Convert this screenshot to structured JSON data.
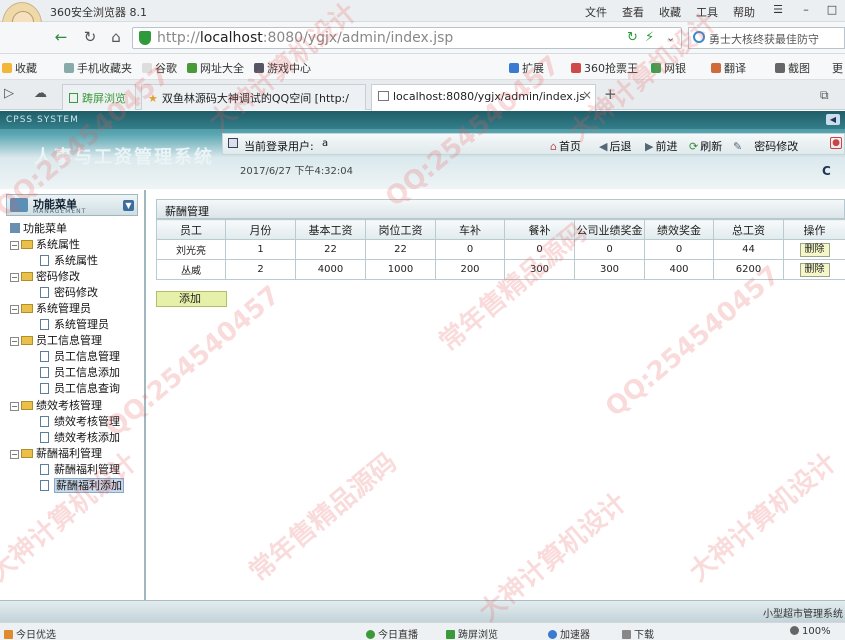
{
  "browser": {
    "title": "360安全浏览器 8.1",
    "menu": [
      "文件",
      "查看",
      "收藏",
      "工具",
      "帮助"
    ],
    "url_prefix": "http://",
    "url_host": "localhost",
    "url_rest": ":8080/ygjx/admin/index.jsp",
    "search_text": "勇士大核终获最佳防守",
    "bookmarks": [
      "收藏",
      "手机收藏夹",
      "谷歌",
      "网址大全",
      "游戏中心",
      "扩展",
      "360抢票王",
      "网银",
      "翻译",
      "截图",
      "更"
    ],
    "tabs": [
      {
        "label": "踌屏浏览"
      },
      {
        "label": "双鱼林源码大神调试的QQ空间 [http:/"
      },
      {
        "label": "localhost:8080/ygjx/admin/index.js"
      }
    ],
    "status_right": "小型超市管理系统",
    "bottom_left": "今日优选",
    "bottom_items": [
      "今日直播",
      "踌屏浏览",
      "加速器",
      "下载",
      "100%"
    ]
  },
  "app": {
    "banner_small": "CPSS SYSTEM",
    "system_title": "人事与工资管理系统",
    "user_label": "当前登录用户:",
    "user_value": "a",
    "datetime": "2017/6/27 下午4:32:04",
    "nav": [
      "首页",
      "后退",
      "前进",
      "刷新",
      "密码修改"
    ],
    "logo_tail": "C"
  },
  "sidebar": {
    "header_title": "功能菜单",
    "header_sub": "MANAGEMENT",
    "root": "功能菜单",
    "groups": [
      {
        "label": "系统属性",
        "items": [
          "系统属性"
        ]
      },
      {
        "label": "密码修改",
        "items": [
          "密码修改"
        ]
      },
      {
        "label": "系统管理员",
        "items": [
          "系统管理员"
        ]
      },
      {
        "label": "员工信息管理",
        "items": [
          "员工信息管理",
          "员工信息添加",
          "员工信息查询"
        ]
      },
      {
        "label": "绩效考核管理",
        "items": [
          "绩效考核管理",
          "绩效考核添加"
        ]
      },
      {
        "label": "薪酬福利管理",
        "items": [
          "薪酬福利管理",
          "薪酬福利添加"
        ]
      }
    ]
  },
  "content": {
    "panel_title": "薪酬管理",
    "columns": [
      "员工",
      "月份",
      "基本工资",
      "岗位工资",
      "车补",
      "餐补",
      "公司业绩奖金",
      "绩效奖金",
      "总工资",
      "操作"
    ],
    "rows": [
      [
        "刘光亮",
        "1",
        "22",
        "22",
        "0",
        "0",
        "0",
        "0",
        "44"
      ],
      [
        "丛威",
        "2",
        "4000",
        "1000",
        "200",
        "300",
        "300",
        "400",
        "6200"
      ]
    ],
    "delete_label": "删除",
    "add_label": "添加"
  },
  "watermarks": [
    "QQ:254540457",
    "大神计算机设计",
    "常年售精品源码"
  ]
}
